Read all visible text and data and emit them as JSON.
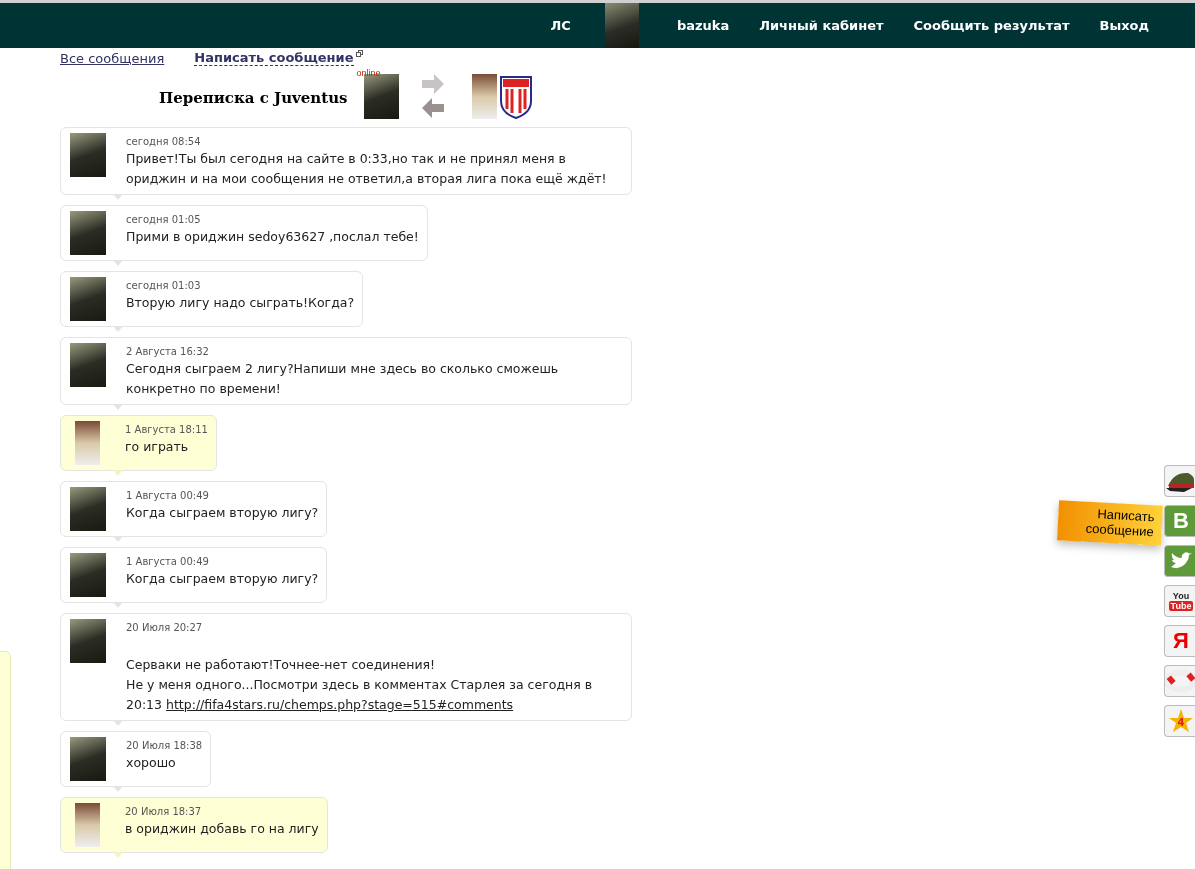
{
  "nav": {
    "items": [
      {
        "kind": "text",
        "label": "ЛС"
      },
      {
        "kind": "avatar"
      },
      {
        "kind": "text",
        "label": "bazuka"
      },
      {
        "kind": "text",
        "label": "Личный кабинет"
      },
      {
        "kind": "text",
        "label": "Сообщить результат"
      },
      {
        "kind": "text",
        "label": "Выход"
      }
    ]
  },
  "links": {
    "all": "Все сообщения",
    "write": "Написать сообщение"
  },
  "conversation": {
    "title": "Переписка с Juventus",
    "status": "online"
  },
  "messages": [
    {
      "kind": "own",
      "date": "сегодня 08:54",
      "lines": [
        "Привет!Ты был сегодня на сайте в 0:33,но так и не принял меня в ориджин и на мои сообщения не ответил,а вторая лига пока ещё ждёт!"
      ]
    },
    {
      "kind": "own",
      "date": "сегодня 01:05",
      "lines": [
        "Прими в ориджин sedoy63627 ,послал тебе!"
      ]
    },
    {
      "kind": "own",
      "date": "сегодня 01:03",
      "lines": [
        "Вторую лигу надо сыграть!Когда?"
      ]
    },
    {
      "kind": "own",
      "date": "2 Августа 16:32",
      "lines": [
        "Сегодня сыграем 2 лигу?Напиши мне здесь во сколько сможешь конкретно по времени!"
      ]
    },
    {
      "kind": "partner",
      "date": "1 Августа 18:11",
      "lines": [
        "го играть"
      ]
    },
    {
      "kind": "own",
      "date": "1 Августа 00:49",
      "lines": [
        "Когда сыграем вторую лигу?"
      ]
    },
    {
      "kind": "own",
      "date": "1 Августа 00:49",
      "lines": [
        "Когда сыграем вторую лигу?"
      ]
    },
    {
      "kind": "own",
      "date": "20 Июля 20:27",
      "blank_line": true,
      "lines": [
        "Серваки не работают!Точнее-нет соединения!",
        "Не у меня одного...Посмотри здесь в комментах Старлея за сегодня в 20:13"
      ],
      "link": "http://fifa4stars.ru/chemps.php?stage=515#comments"
    },
    {
      "kind": "own",
      "date": "20 Июля 18:38",
      "lines": [
        "хорошо"
      ]
    },
    {
      "kind": "partner",
      "date": "20 Июля 18:37",
      "lines": [
        "в ориджин добавь го на лигу"
      ]
    }
  ],
  "side_tab": {
    "label": "Написать сообщение"
  },
  "side_buttons": [
    {
      "kind": "cap"
    },
    {
      "kind": "vk",
      "label": "B"
    },
    {
      "kind": "twitter"
    },
    {
      "kind": "youtube",
      "label_lines": [
        "You",
        "Tube"
      ]
    },
    {
      "kind": "yandex",
      "label": "Я"
    },
    {
      "kind": "lifebuoy"
    },
    {
      "kind": "star",
      "label": "4"
    }
  ]
}
